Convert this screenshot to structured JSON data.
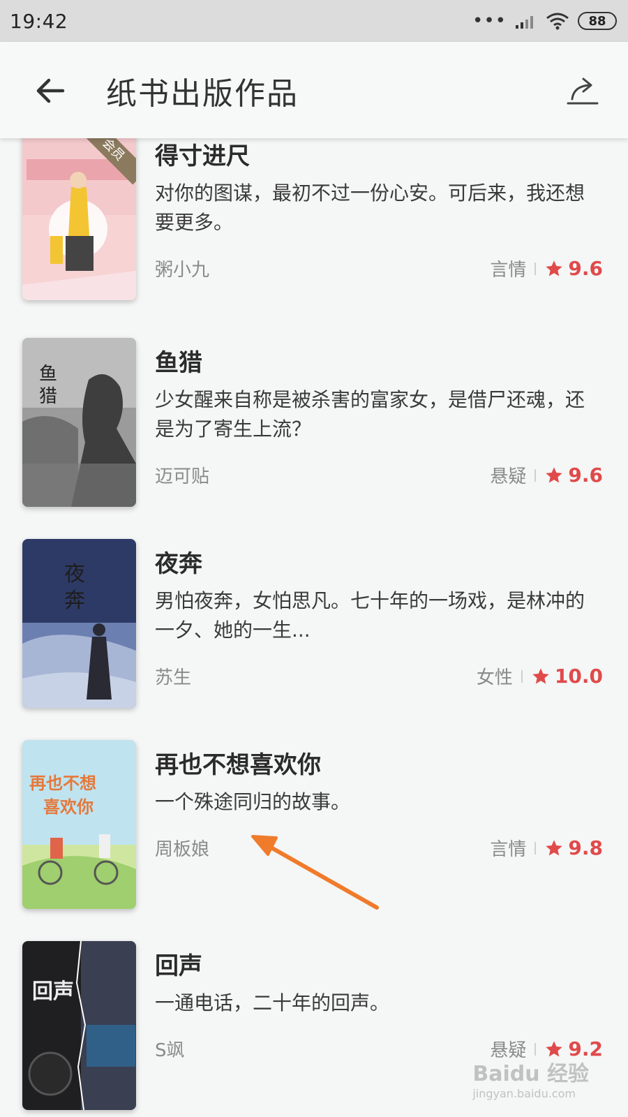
{
  "status_bar": {
    "time": "19:42",
    "battery": "88"
  },
  "header": {
    "title": "纸书出版作品"
  },
  "books": [
    {
      "title": "得寸进尺",
      "desc": "对你的图谋，最初不过一份心安。可后来，我还想要更多。",
      "author": "粥小九",
      "genre": "言情",
      "score": "9.6",
      "badge": "会员"
    },
    {
      "title": "鱼猎",
      "desc": "少女醒来自称是被杀害的富家女，是借尸还魂，还是为了寄生上流？",
      "author": "迈可贴",
      "genre": "悬疑",
      "score": "9.6"
    },
    {
      "title": "夜奔",
      "desc": "男怕夜奔，女怕思凡。七十年的一场戏，是林冲的一夕、她的一生...",
      "author": "苏生",
      "genre": "女性",
      "score": "10.0"
    },
    {
      "title": "再也不想喜欢你",
      "desc": "一个殊途同归的故事。",
      "author": "周板娘",
      "genre": "言情",
      "score": "9.8"
    },
    {
      "title": "回声",
      "desc": "一通电话，二十年的回声。",
      "author": "S飒",
      "genre": "悬疑",
      "score": "9.2"
    }
  ],
  "watermark": {
    "brand": "Baidu 经验",
    "url": "jingyan.baidu.com"
  },
  "colors": {
    "score": "#e04a4a",
    "accent_arrow": "#f07b2a"
  }
}
